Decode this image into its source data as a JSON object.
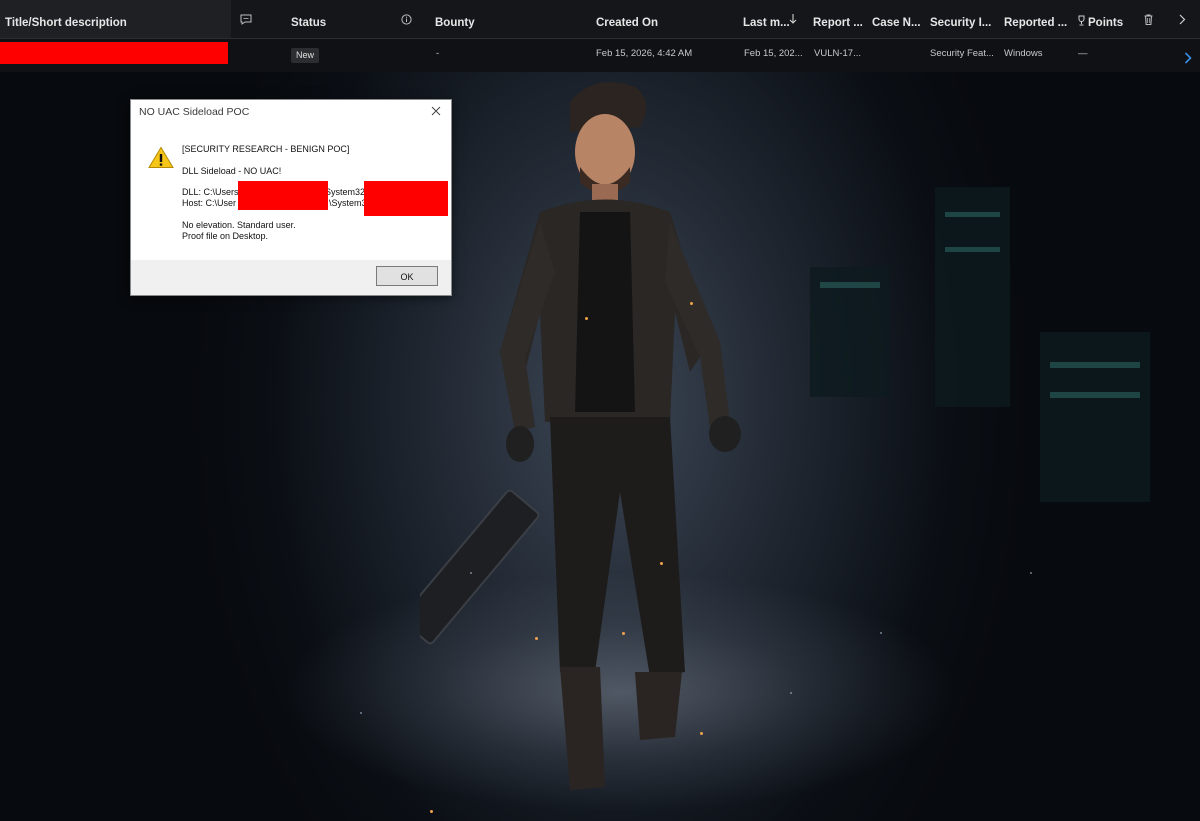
{
  "table": {
    "columns": [
      {
        "label": "Title/Short description"
      },
      {
        "label": "Status"
      },
      {
        "label": "Bounty"
      },
      {
        "label": "Created On"
      },
      {
        "label": "Last m..."
      },
      {
        "label": "Report ..."
      },
      {
        "label": "Case N..."
      },
      {
        "label": "Security I..."
      },
      {
        "label": "Reported ..."
      },
      {
        "label": "Points"
      }
    ],
    "row": {
      "status": "New",
      "bounty": "-",
      "created_on": "Feb 15, 2026, 4:42 AM",
      "last_modified": "Feb 15, 202...",
      "report_id": "VULN-17...",
      "case_number": "",
      "security_impact": "Security Feat...",
      "reported_product": "Windows",
      "points": "—"
    }
  },
  "dialog": {
    "title": "NO UAC Sideload POC",
    "line1": "[SECURITY RESEARCH - BENIGN POC]",
    "line2": "DLL Sideload - NO UAC!",
    "dll_prefix": "DLL: C:\\Users",
    "dll_suffix": "System32",
    "host_prefix": "Host: C:\\User",
    "host_suffix": "\\System3",
    "line5": "No elevation. Standard user.",
    "line6": "Proof file on Desktop.",
    "ok_label": "OK"
  },
  "icons": {
    "comment": "comment-icon",
    "info": "info-icon",
    "sort": "sort-arrow-down-icon",
    "trophy": "trophy-icon",
    "delete": "trash-icon",
    "chevron": "chevron-right-icon",
    "warning": "warning-icon",
    "close": "close-icon"
  },
  "colors": {
    "redaction": "#ff0000",
    "header_bg": "#141619",
    "accent_blue": "#3a8ee6"
  }
}
